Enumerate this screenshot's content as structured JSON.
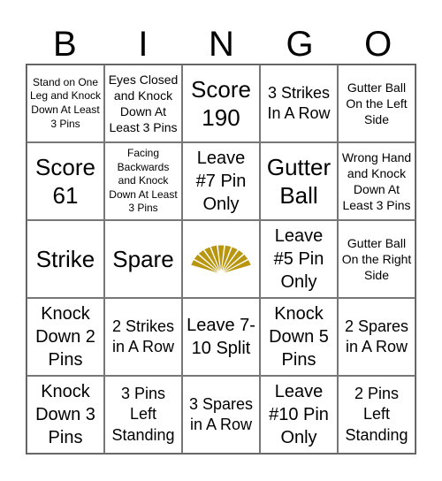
{
  "header": {
    "letters": [
      "B",
      "I",
      "N",
      "G",
      "O"
    ]
  },
  "free_space": {
    "icon": "fan-logo-icon",
    "color": "#B8960F"
  },
  "cells": [
    {
      "text": "Stand on One Leg and Knock Down At Least 3 Pins",
      "size": "s-xs"
    },
    {
      "text": "Eyes Closed and Knock Down At Least 3 Pins",
      "size": "s-sm"
    },
    {
      "text": "Score 190",
      "size": "s-xl"
    },
    {
      "text": "3 Strikes In A Row",
      "size": "s-md"
    },
    {
      "text": "Gutter Ball On the Left Side",
      "size": "s-sm"
    },
    {
      "text": "Score 61",
      "size": "s-xl"
    },
    {
      "text": "Facing Backwards and Knock Down At Least 3 Pins",
      "size": "s-xs"
    },
    {
      "text": "Leave #7 Pin Only",
      "size": "s-lg"
    },
    {
      "text": "Gutter Ball",
      "size": "s-xl"
    },
    {
      "text": "Wrong Hand and Knock Down At Least 3 Pins",
      "size": "s-sm"
    },
    {
      "text": "Strike",
      "size": "s-xl"
    },
    {
      "text": "Spare",
      "size": "s-xl"
    },
    {
      "text": "",
      "size": "free"
    },
    {
      "text": "Leave #5 Pin Only",
      "size": "s-lg"
    },
    {
      "text": "Gutter Ball On the Right Side",
      "size": "s-sm"
    },
    {
      "text": "Knock Down 2 Pins",
      "size": "s-lg"
    },
    {
      "text": "2 Strikes in A Row",
      "size": "s-md"
    },
    {
      "text": "Leave 7-10 Split",
      "size": "s-lg"
    },
    {
      "text": "Knock Down 5 Pins",
      "size": "s-lg"
    },
    {
      "text": "2 Spares in A Row",
      "size": "s-md"
    },
    {
      "text": "Knock Down 3 Pins",
      "size": "s-lg"
    },
    {
      "text": "3 Pins Left Standing",
      "size": "s-md"
    },
    {
      "text": "3 Spares in A Row",
      "size": "s-md"
    },
    {
      "text": "Leave #10 Pin Only",
      "size": "s-lg"
    },
    {
      "text": "2 Pins Left Standing",
      "size": "s-md"
    }
  ]
}
